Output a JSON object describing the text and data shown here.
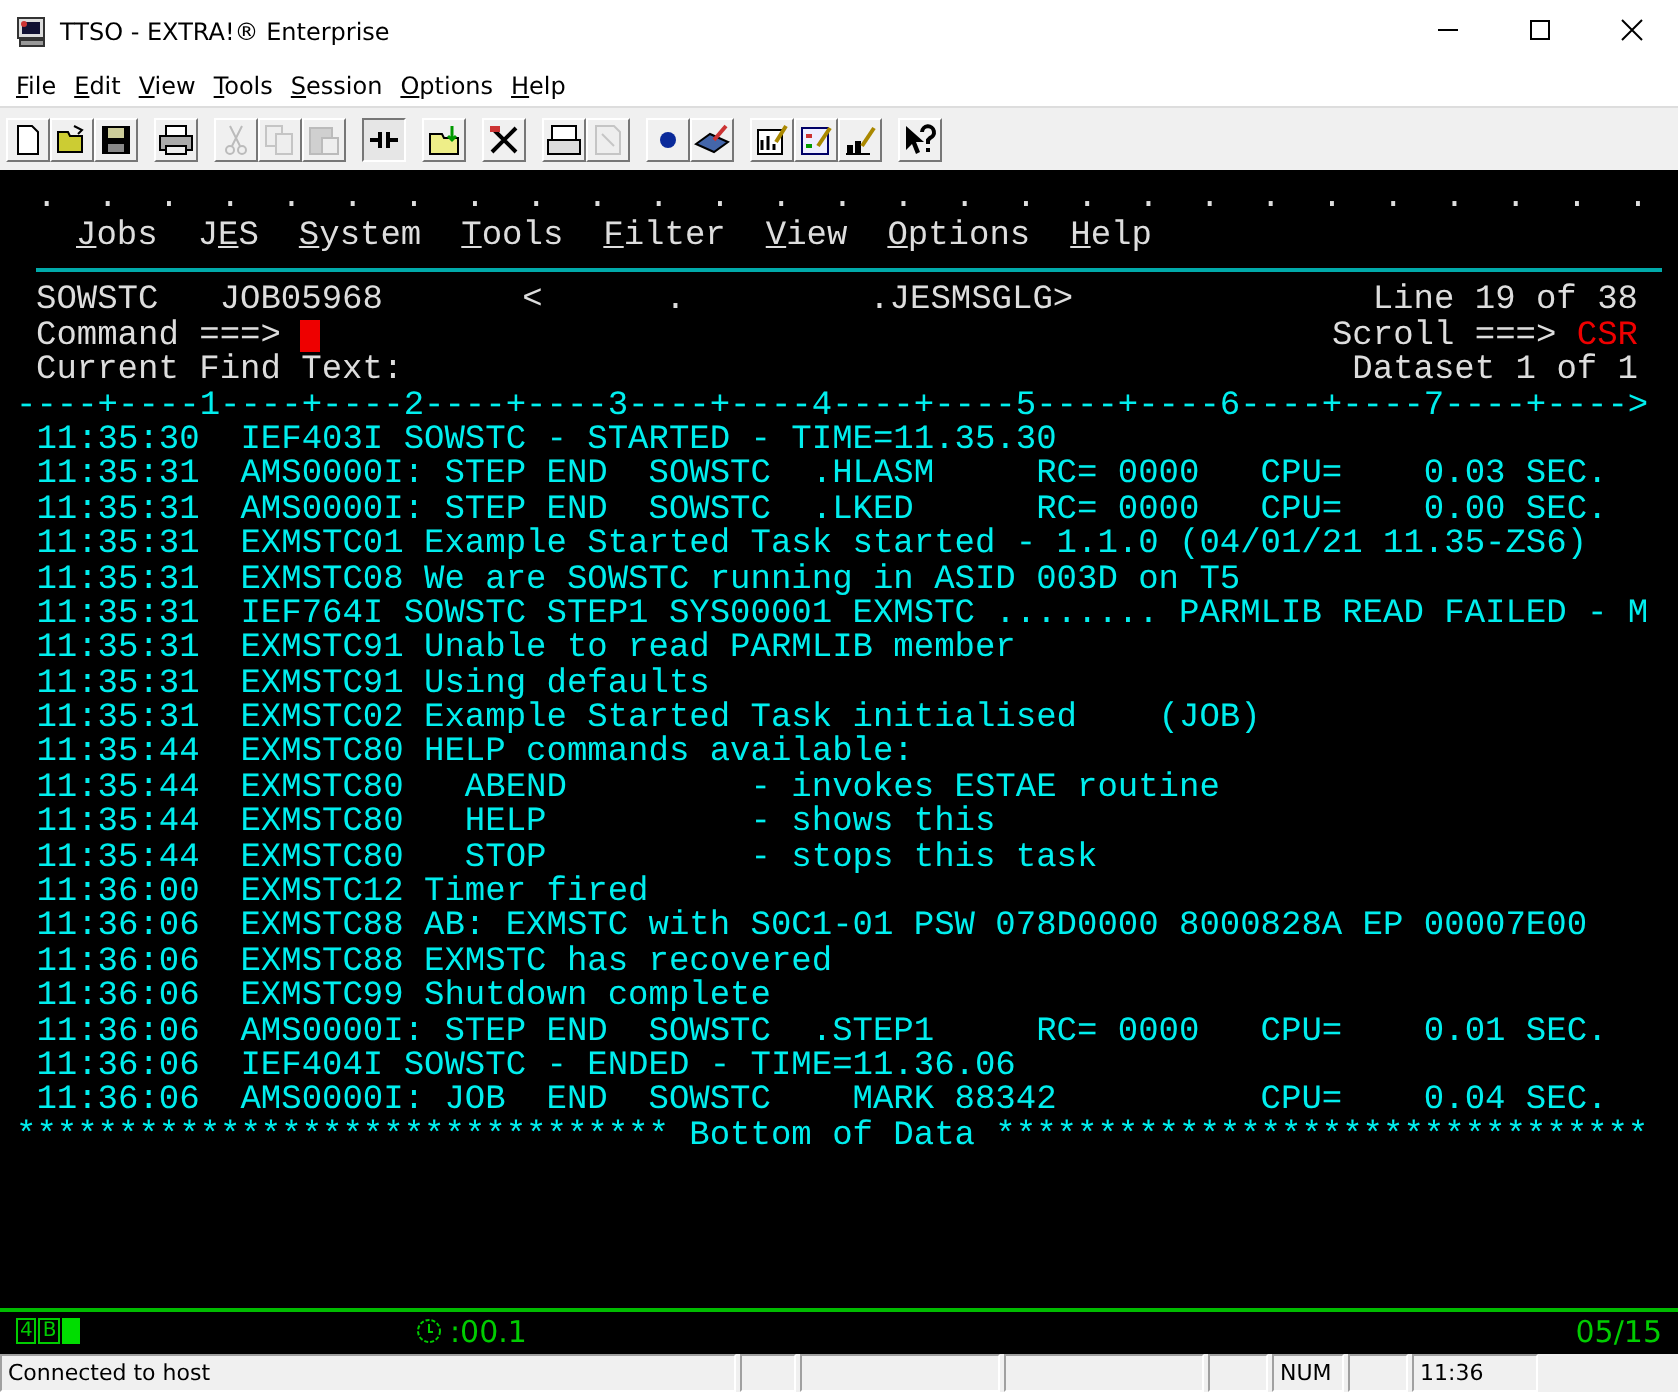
{
  "window": {
    "title": "TTSO - EXTRA!® Enterprise"
  },
  "menu_bar": [
    {
      "key": "F",
      "rest": "ile"
    },
    {
      "key": "E",
      "rest": "dit"
    },
    {
      "key": "V",
      "rest": "iew"
    },
    {
      "key": "T",
      "rest": "ools"
    },
    {
      "key": "S",
      "rest": "ession"
    },
    {
      "key": "O",
      "rest": "ptions"
    },
    {
      "key": "H",
      "rest": "elp"
    }
  ],
  "toolbar": [
    [
      {
        "kind": "new",
        "disabled": false,
        "pressed": false
      },
      {
        "kind": "open",
        "disabled": false,
        "pressed": false
      },
      {
        "kind": "save",
        "disabled": false,
        "pressed": false
      }
    ],
    [
      {
        "kind": "print",
        "disabled": false,
        "pressed": false
      }
    ],
    [
      {
        "kind": "cut",
        "disabled": true,
        "pressed": false
      },
      {
        "kind": "copy",
        "disabled": true,
        "pressed": false
      },
      {
        "kind": "paste",
        "disabled": true,
        "pressed": false
      }
    ],
    [
      {
        "kind": "connect",
        "disabled": false,
        "pressed": true
      }
    ],
    [
      {
        "kind": "transfer",
        "disabled": false,
        "pressed": false
      }
    ],
    [
      {
        "kind": "tools",
        "disabled": false,
        "pressed": false
      }
    ],
    [
      {
        "kind": "printscreen",
        "disabled": false,
        "pressed": false
      },
      {
        "kind": "capture",
        "disabled": true,
        "pressed": false
      }
    ],
    [
      {
        "kind": "record",
        "disabled": false,
        "pressed": false
      },
      {
        "kind": "keyboard",
        "disabled": false,
        "pressed": false
      }
    ],
    [
      {
        "kind": "editchart",
        "disabled": false,
        "pressed": false
      },
      {
        "kind": "editform",
        "disabled": false,
        "pressed": false
      },
      {
        "kind": "editkeys",
        "disabled": false,
        "pressed": false
      }
    ],
    [
      {
        "kind": "help",
        "disabled": false,
        "pressed": false
      }
    ]
  ],
  "terminal": {
    "dot_row": " .  .  .  .  .  .  .  .  .  .  .  .  .  .  .  .  .  .  .  .  .  .  .  .  .  .  .",
    "menu": [
      {
        "key": "J",
        "rest": "obs"
      },
      {
        "pre": "J",
        "key": "E",
        "rest": "S"
      },
      {
        "key": "S",
        "rest": "ystem"
      },
      {
        "key": "T",
        "rest": "ools"
      },
      {
        "key": "F",
        "rest": "ilter"
      },
      {
        "key": "V",
        "rest": "iew"
      },
      {
        "key": "O",
        "rest": "ptions"
      },
      {
        "key": "H",
        "rest": "elp"
      }
    ],
    "job_name": "SOWSTC   JOB05968",
    "dataset_path": "<      .         .JESMSGLG>",
    "line_info": "Line 19 of 38",
    "command_label": "Command ===>",
    "scroll_label": "Scroll ===>",
    "scroll_value": "CSR",
    "find_label": "Current Find Text:",
    "dataset_info": "Dataset 1 of 1",
    "ruler": "----+----1----+----2----+----3----+----4----+----5----+----6----+----7----+---->",
    "lines": [
      " 11:35:30  IEF403I SOWSTC - STARTED - TIME=11.35.30",
      " 11:35:31  AMS0000I: STEP END  SOWSTC  .HLASM     RC= 0000   CPU=    0.03 SEC.",
      " 11:35:31  AMS0000I: STEP END  SOWSTC  .LKED      RC= 0000   CPU=    0.00 SEC.",
      " 11:35:31  EXMSTC01 Example Started Task started - 1.1.0 (04/01/21 11.35-ZS6)",
      " 11:35:31  EXMSTC08 We are SOWSTC running in ASID 003D on T5",
      " 11:35:31  IEF764I SOWSTC STEP1 SYS00001 EXMSTC ........ PARMLIB READ FAILED - M",
      " 11:35:31  EXMSTC91 Unable to read PARMLIB member",
      " 11:35:31  EXMSTC91 Using defaults",
      " 11:35:31  EXMSTC02 Example Started Task initialised    (JOB)",
      " 11:35:44  EXMSTC80 HELP commands available:",
      " 11:35:44  EXMSTC80   ABEND         - invokes ESTAE routine",
      " 11:35:44  EXMSTC80   HELP          - shows this",
      " 11:35:44  EXMSTC80   STOP          - stops this task",
      " 11:36:00  EXMSTC12 Timer fired",
      " 11:36:06  EXMSTC88 AB: EXMSTC with S0C1-01 PSW 078D0000 8000828A EP 00007E00",
      " 11:36:06  EXMSTC88 EXMSTC has recovered",
      " 11:36:06  EXMSTC99 Shutdown complete",
      " 11:36:06  AMS0000I: STEP END  SOWSTC  .STEP1     RC= 0000   CPU=    0.01 SEC.",
      " 11:36:06  IEF404I SOWSTC - ENDED - TIME=11.36.06",
      " 11:36:06  AMS0000I: JOB  END  SOWSTC    MARK 88342          CPU=    0.04 SEC."
    ],
    "bottom_line": "******************************** Bottom of Data ********************************"
  },
  "oia": {
    "session_indicator": "4",
    "mode_indicator": "B",
    "response_time": ":00.1",
    "cursor_position": "05/15"
  },
  "status_bar": {
    "message": "Connected to host",
    "num_lock": "NUM",
    "clock": "11:36"
  }
}
